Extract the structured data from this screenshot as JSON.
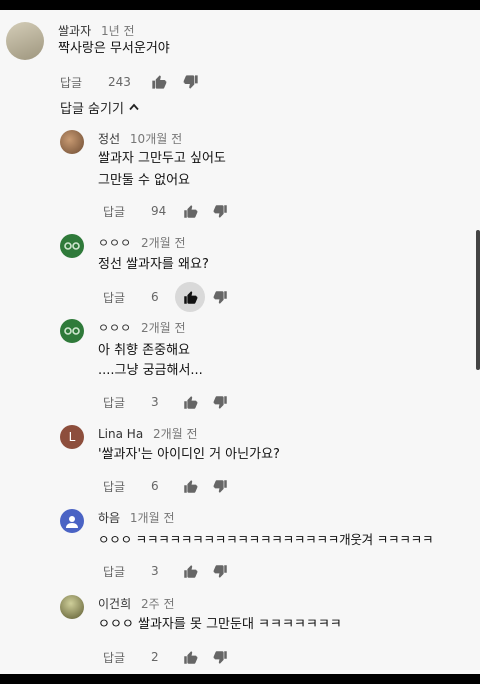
{
  "top_comment": {
    "author": "쌀과자",
    "time": "1년 전",
    "text": "짝사랑은 무서운거야",
    "reply_label": "답글",
    "likes": "243",
    "avatar_color": "#b8b09a"
  },
  "hide_replies_label": "답글 숨기기",
  "replies": [
    {
      "author": "정선",
      "time": "10개월 전",
      "lines": [
        "쌀과자 그만두고 싶어도",
        "        그만둘 수 없어요"
      ],
      "reply_label": "답글",
      "likes": "94",
      "avatar_color": "#a0785a"
    },
    {
      "author": "ㅇㅇㅇ",
      "time": "2개월 전",
      "lines": [
        "정선 쌀과자를 왜요?"
      ],
      "reply_label": "답글",
      "likes": "6",
      "avatar_color": "#2f7a3a",
      "liked": true
    },
    {
      "author": "ㅇㅇㅇ",
      "time": "2개월 전",
      "lines": [
        "아 취향 존중해요",
        "....그냥 궁금해서..."
      ],
      "reply_label": "답글",
      "likes": "3",
      "avatar_color": "#2f7a3a"
    },
    {
      "author": "Lina Ha",
      "time": "2개월 전",
      "lines": [
        "'쌀과자'는 아이디인 거 아닌가요?"
      ],
      "reply_label": "답글",
      "likes": "6",
      "avatar_color": "#8d4e3c",
      "avatar_letter": "L"
    },
    {
      "author": "하음",
      "time": "1개월 전",
      "lines": [
        "ㅇㅇㅇ ㅋㅋㅋㅋㅋㅋㅋㅋㅋㅋㅋㅋㅋㅋㅋㅋㅋㅋ개웃겨 ㅋㅋㅋㅋㅋ"
      ],
      "reply_label": "답글",
      "likes": "3",
      "avatar_color": "#4a63c4"
    },
    {
      "author": "이건희",
      "time": "2주 전",
      "lines": [
        "ㅇㅇㅇ 쌀과자를 못 그만둔대 ㅋㅋㅋㅋㅋㅋㅋ"
      ],
      "reply_label": "답글",
      "likes": "2",
      "avatar_color": "#7c7a48"
    }
  ]
}
